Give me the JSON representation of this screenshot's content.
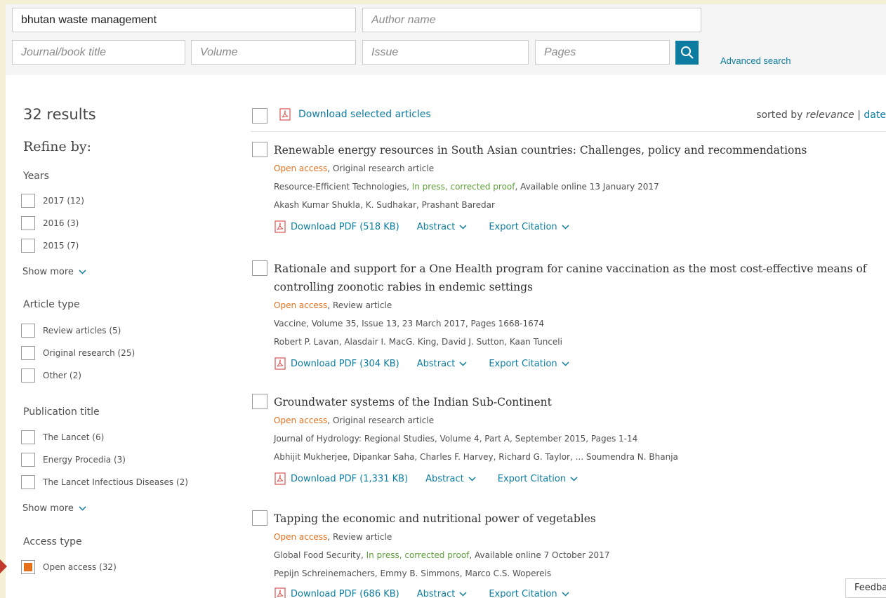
{
  "search": {
    "terms_value": "bhutan waste management",
    "author_placeholder": "Author name",
    "journal_placeholder": "Journal/book title",
    "volume_placeholder": "Volume",
    "issue_placeholder": "Issue",
    "pages_placeholder": "Pages",
    "advanced_label": "Advanced search"
  },
  "results_count": "32 results",
  "refine_label": "Refine by:",
  "facets": {
    "years": {
      "title": "Years",
      "items": [
        {
          "label": "2017 (12)"
        },
        {
          "label": "2016 (3)"
        },
        {
          "label": "2015 (7)"
        }
      ],
      "show_more": "Show more"
    },
    "article_type": {
      "title": "Article type",
      "items": [
        {
          "label": "Review articles (5)"
        },
        {
          "label": "Original research (25)"
        },
        {
          "label": "Other (2)"
        }
      ]
    },
    "publication_title": {
      "title": "Publication title",
      "items": [
        {
          "label": "The Lancet (6)"
        },
        {
          "label": "Energy Procedia (3)"
        },
        {
          "label": "The Lancet Infectious Diseases (2)"
        }
      ],
      "show_more": "Show more"
    },
    "access_type": {
      "title": "Access type",
      "items": [
        {
          "label": "Open access (32)",
          "checked": true
        }
      ]
    }
  },
  "toolbar": {
    "download_selected": "Download selected articles",
    "sorted_by": "sorted by",
    "relevance": "relevance",
    "separator": "|",
    "date": "date"
  },
  "results": [
    {
      "title": "Renewable energy resources in South Asian countries: Challenges, policy and recommendations",
      "access": "Open access",
      "type": ", Original research article",
      "source": "Resource-Efficient Technologies, ",
      "press": "In press, corrected proof",
      "source_tail": ", Available online 13 January 2017",
      "authors": "Akash Kumar Shukla, K. Sudhakar, Prashant Baredar",
      "pdf": "Download PDF (518 KB)",
      "abstract": "Abstract",
      "export": "Export Citation"
    },
    {
      "title": "Rationale and support for a One Health program for canine vaccination as the most cost-effective means of controlling zoonotic rabies in endemic settings",
      "access": "Open access",
      "type": ", Review article",
      "source": "Vaccine, Volume 35, Issue 13, 23 March 2017, Pages 1668-1674",
      "press": "",
      "source_tail": "",
      "authors": "Robert P. Lavan, Alasdair I. MacG. King, David J. Sutton, Kaan Tunceli",
      "pdf": "Download PDF (304 KB)",
      "abstract": "Abstract",
      "export": "Export Citation"
    },
    {
      "title": "Groundwater systems of the Indian Sub-Continent",
      "access": "Open access",
      "type": ", Original research article",
      "source": "Journal of Hydrology: Regional Studies, Volume 4, Part A, September 2015, Pages 1-14",
      "press": "",
      "source_tail": "",
      "authors": "Abhijit Mukherjee, Dipankar Saha, Charles F. Harvey, Richard G. Taylor, ... Soumendra N. Bhanja",
      "pdf": "Download PDF (1,331 KB)",
      "abstract": "Abstract",
      "export": "Export Citation"
    },
    {
      "title": "Tapping the economic and nutritional power of vegetables",
      "access": "Open access",
      "type": ", Review article",
      "source": "Global Food Security, ",
      "press": "In press, corrected proof",
      "source_tail": ", Available online 7 October 2017",
      "authors": "Pepijn Schreinemachers, Emmy B. Simmons, Marco C.S. Wopereis",
      "pdf": "Download PDF (686 KB)",
      "abstract": "Abstract",
      "export": "Export Citation"
    }
  ],
  "feedback": "Feedba",
  "colors": {
    "page_bg": "#f3f0d6",
    "link": "#0c7da0",
    "open_access": "#e4701e",
    "in_press": "#5e9e3a",
    "search_button": "#0c7da0"
  }
}
